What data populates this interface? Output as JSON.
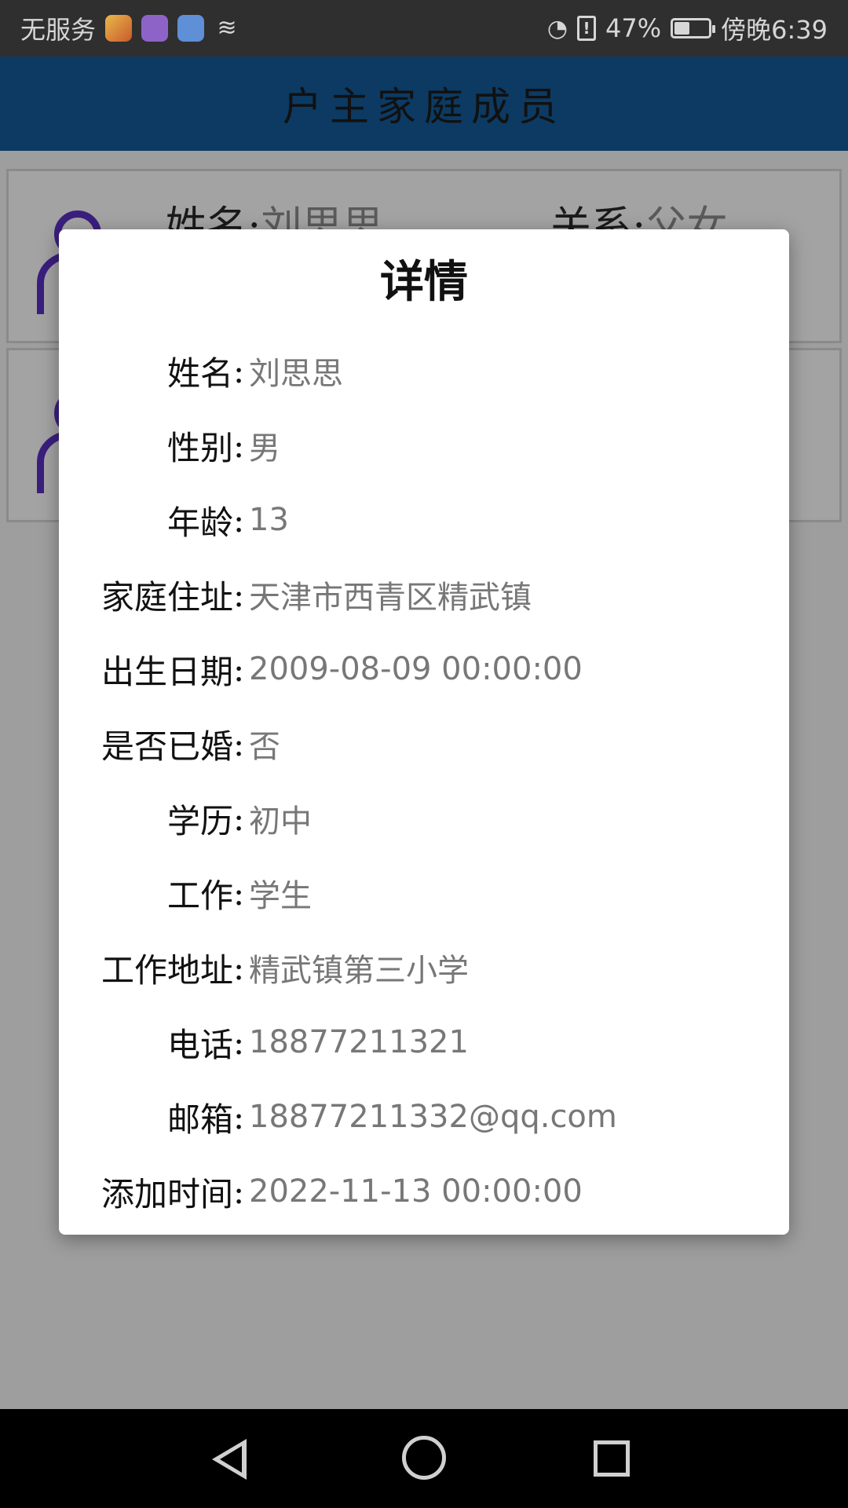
{
  "status_bar": {
    "carrier": "无服务",
    "app_icons": [
      "game-icon",
      "purple-app-icon",
      "music-icon",
      "swoosh-icon"
    ],
    "battery_percent": "47%",
    "battery_level": 0.47,
    "time": "傍晚6:39"
  },
  "header": {
    "title": "户主家庭成员"
  },
  "background_list": [
    {
      "name_label": "姓名:",
      "name_value": "刘思思",
      "relation_label": "关系:",
      "relation_value": "父女"
    }
  ],
  "modal": {
    "title": "详情",
    "rows": [
      {
        "label": "姓名",
        "value": "刘思思"
      },
      {
        "label": "性别",
        "value": "男"
      },
      {
        "label": "年龄",
        "value": "13"
      },
      {
        "label": "家庭住址",
        "value": "天津市西青区精武镇"
      },
      {
        "label": "出生日期",
        "value": "2009-08-09 00:00:00"
      },
      {
        "label": "是否已婚",
        "value": "否"
      },
      {
        "label": "学历",
        "value": "初中"
      },
      {
        "label": "工作",
        "value": "学生"
      },
      {
        "label": "工作地址",
        "value": "精武镇第三小学"
      },
      {
        "label": "电话",
        "value": "18877211321"
      },
      {
        "label": "邮箱",
        "value": "18877211332@qq.com"
      },
      {
        "label": "添加时间",
        "value": "2022-11-13 00:00:00"
      }
    ]
  },
  "colors": {
    "header_bg": "#0c3a62",
    "status_bg": "#2f2f2f",
    "overlay_bg": "#9e9e9e",
    "label_color": "#111111",
    "value_color": "#777777",
    "avatar_color": "#3a1f7e"
  }
}
